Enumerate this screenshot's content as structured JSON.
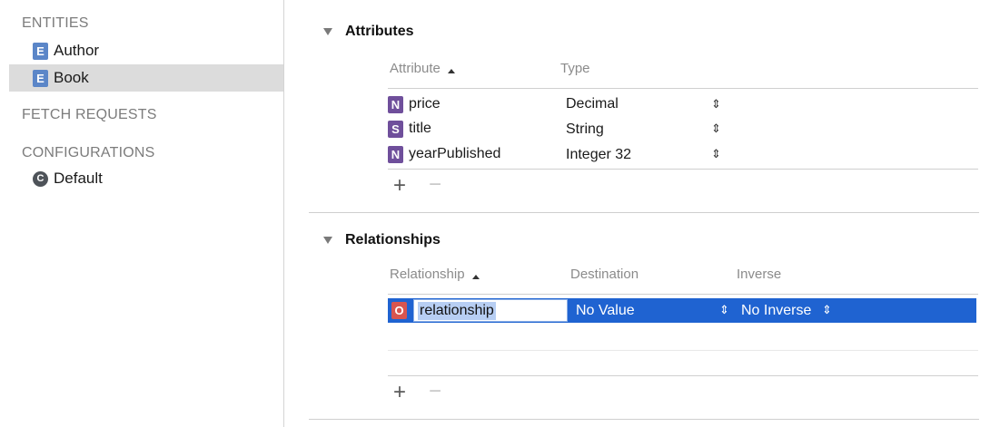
{
  "sidebar": {
    "entities_header": "ENTITIES",
    "entities": [
      {
        "badge": "E",
        "label": "Author",
        "selected": false
      },
      {
        "badge": "E",
        "label": "Book",
        "selected": true
      }
    ],
    "fetch_requests_header": "FETCH REQUESTS",
    "configurations_header": "CONFIGURATIONS",
    "configurations": [
      {
        "badge": "C",
        "label": "Default"
      }
    ]
  },
  "attributes": {
    "title": "Attributes",
    "col_attribute": "Attribute",
    "col_type": "Type",
    "rows": [
      {
        "badge": "N",
        "name": "price",
        "type": "Decimal"
      },
      {
        "badge": "S",
        "name": "title",
        "type": "String"
      },
      {
        "badge": "N",
        "name": "yearPublished",
        "type": "Integer 32"
      }
    ],
    "add_label": "+",
    "remove_label": "−"
  },
  "relationships": {
    "title": "Relationships",
    "col_relationship": "Relationship",
    "col_destination": "Destination",
    "col_inverse": "Inverse",
    "rows": [
      {
        "badge": "O",
        "name": "relationship",
        "destination": "No Value",
        "inverse": "No Inverse"
      }
    ],
    "add_label": "+",
    "remove_label": "−"
  },
  "colors": {
    "selection": "#1f63d1",
    "entity_badge": "#5b86c8",
    "attribute_badge": "#6f4f9b",
    "relationship_badge": "#d8554f"
  }
}
